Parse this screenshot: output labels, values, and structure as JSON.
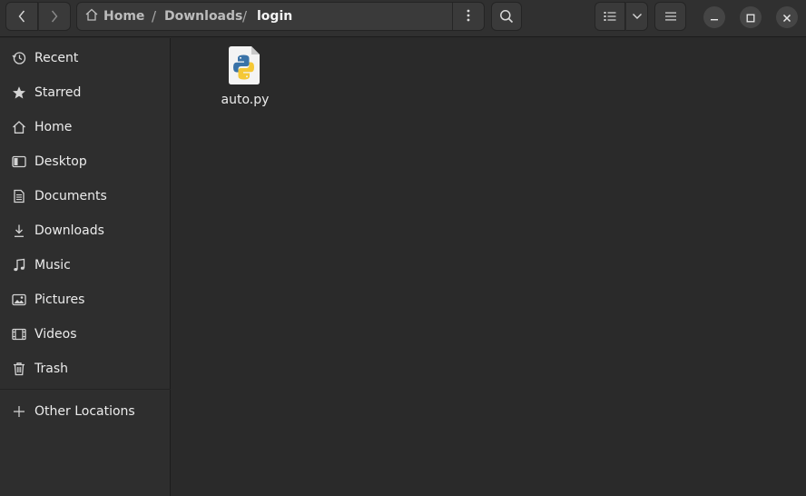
{
  "header": {
    "path": {
      "home": "Home",
      "segments": [
        "Downloads",
        "login"
      ],
      "separator": "/"
    },
    "icons": {
      "back": "chevron-left-icon",
      "forward": "chevron-right-icon",
      "path_menu": "vertical-dots-icon",
      "search": "search-icon",
      "view_list": "list-view-icon",
      "view_dropdown": "chevron-down-icon",
      "menu": "hamburger-icon",
      "minimize": "minimize-icon",
      "maximize": "maximize-icon",
      "close": "close-icon"
    }
  },
  "sidebar": {
    "items": [
      {
        "label": "Recent",
        "icon": "clock-icon"
      },
      {
        "label": "Starred",
        "icon": "star-icon"
      },
      {
        "label": "Home",
        "icon": "home-icon"
      },
      {
        "label": "Desktop",
        "icon": "desktop-icon"
      },
      {
        "label": "Documents",
        "icon": "document-icon"
      },
      {
        "label": "Downloads",
        "icon": "download-icon"
      },
      {
        "label": "Music",
        "icon": "music-icon"
      },
      {
        "label": "Pictures",
        "icon": "picture-icon"
      },
      {
        "label": "Videos",
        "icon": "video-icon"
      },
      {
        "label": "Trash",
        "icon": "trash-icon"
      }
    ],
    "other_locations": {
      "label": "Other Locations",
      "icon": "plus-icon"
    }
  },
  "files": [
    {
      "name": "auto.py",
      "icon": "python-file-icon"
    }
  ],
  "colors": {
    "window_bg": "#2a2a2a",
    "sidebar_bg": "#2e2e2e",
    "headerbar_bg": "#303030",
    "button_bg": "#3a3a3a",
    "python_blue": "#3a73a8",
    "python_yellow": "#f5c835"
  }
}
